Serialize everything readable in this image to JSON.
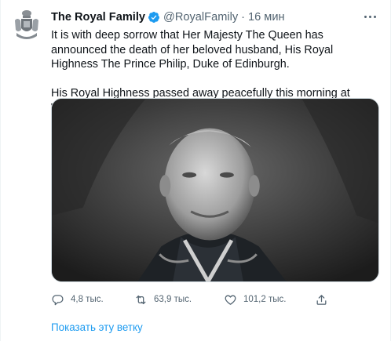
{
  "author": {
    "name": "The Royal Family",
    "handle": "@RoyalFamily",
    "separator": "·",
    "time": "16 мин",
    "verified_color": "#1d9bf0"
  },
  "tweet": {
    "paragraphs": [
      "It is with deep sorrow that Her Majesty The Queen has announced the death of her beloved husband, His Royal Highness The Prince Philip, Duke of Edinburgh.",
      "His Royal Highness passed away peacefully this morning at Windsor Castle."
    ]
  },
  "actions": {
    "reply": {
      "icon": "reply-icon",
      "count": "4,8 тыс."
    },
    "retweet": {
      "icon": "retweet-icon",
      "count": "63,9 тыс."
    },
    "like": {
      "icon": "heart-icon",
      "count": "101,2 тыс."
    },
    "share": {
      "icon": "share-icon"
    }
  },
  "show_thread": "Показать эту ветку",
  "colors": {
    "link": "#1d9bf0",
    "secondary_text": "#536471",
    "text": "#0f1419"
  }
}
